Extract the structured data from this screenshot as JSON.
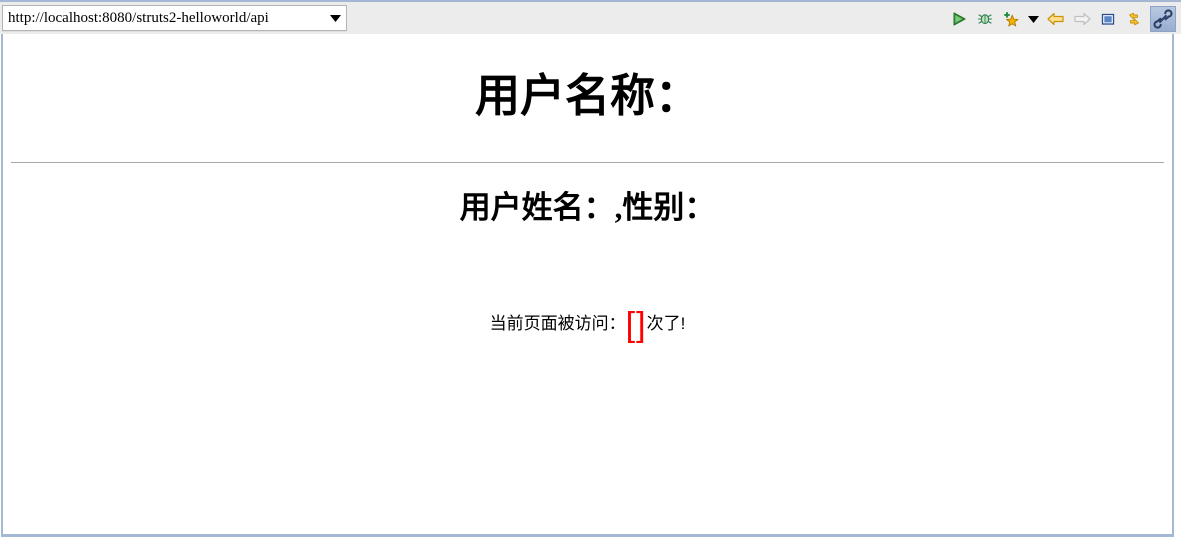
{
  "browser": {
    "url_value": "http://localhost:8080/struts2-helloworld/api",
    "url_placeholder": "Enter URL",
    "dropdown_caret": "▼",
    "toolbar_buttons": [
      {
        "name": "run-icon",
        "label": "Run"
      },
      {
        "name": "debug-icon",
        "label": "Debug"
      },
      {
        "name": "new-bookmark-icon",
        "label": "New"
      },
      {
        "name": "chevron-down-icon",
        "label": "More"
      },
      {
        "name": "back-arrow-icon",
        "label": "Back"
      },
      {
        "name": "forward-arrow-icon",
        "label": "Forward"
      },
      {
        "name": "stop-icon",
        "label": "Stop"
      },
      {
        "name": "refresh-icon",
        "label": "Refresh"
      },
      {
        "name": "link-icon",
        "label": "Link"
      }
    ]
  },
  "page": {
    "title": "用户名称：",
    "sub_title": "用户姓名：,性别：",
    "visit_prefix": "当前页面被访问：",
    "visit_count": "[]",
    "visit_suffix": "次了!"
  },
  "colors": {
    "toolbar_bg": "#ececed",
    "frame_border": "#a4b8d4",
    "divider": "#a9a9a9",
    "count_red": "#ff0000",
    "text": "#000000"
  }
}
